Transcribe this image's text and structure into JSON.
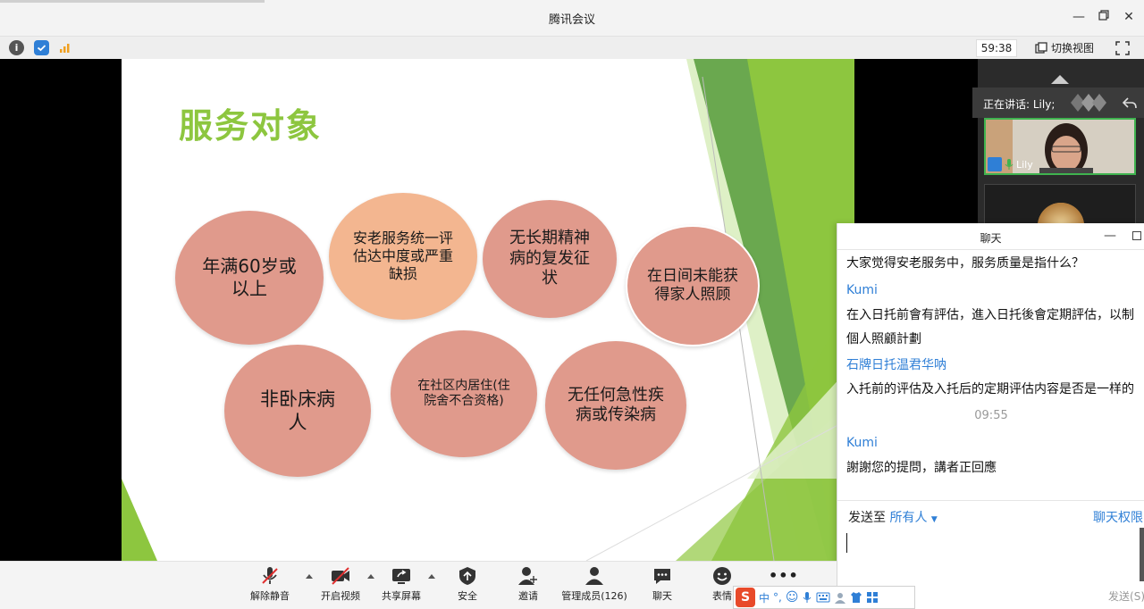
{
  "window": {
    "title": "腾讯会议"
  },
  "infobar": {
    "timer": "59:38",
    "switch_view": "切换视图"
  },
  "slide": {
    "title": "服务对象",
    "bubbles": [
      "年满60岁或以上",
      "安老服务统一评估达中度或严重缺损",
      "无长期精神病的复发征状",
      "在日间未能获得家人照顾",
      "非卧床病人",
      "在社区内居住(住院舍不合资格)",
      "无任何急性疾病或传染病"
    ]
  },
  "video": {
    "speaking_label": "正在讲话: Lily;",
    "participant_name": "Lily"
  },
  "chat": {
    "title": "聊天",
    "messages": [
      {
        "text": "大家觉得安老服务中，服务质量是指什么？"
      },
      {
        "sender": "Kumi"
      },
      {
        "text": "在入日托前會有評估，進入日托後會定期評估，以制"
      },
      {
        "text": "個人照顧計劃"
      },
      {
        "sender": "石牌日托温君华呐"
      },
      {
        "text": "入托前的评估及入托后的定期评估内容是否是一样的"
      },
      {
        "time": "09:55"
      },
      {
        "sender": "Kumi"
      },
      {
        "text": "謝謝您的提問，講者正回應"
      }
    ],
    "send_to_label": "发送至",
    "send_to_target": "所有人",
    "permission": "聊天权限",
    "send_button": "发送(S)"
  },
  "toolbar": {
    "mute": "解除静音",
    "video": "开启视频",
    "share": "共享屏幕",
    "security": "安全",
    "invite": "邀请",
    "members": "管理成员(126)",
    "chat": "聊天",
    "emoji": "表情",
    "more_icon": "•••"
  },
  "ime": {
    "mode": "中",
    "punct": "°,"
  },
  "colors": {
    "accent": "#2f7fd6",
    "slide_green": "#8dc63f",
    "bubble_red": "#e09a8c",
    "bubble_orange": "#f3b690"
  }
}
